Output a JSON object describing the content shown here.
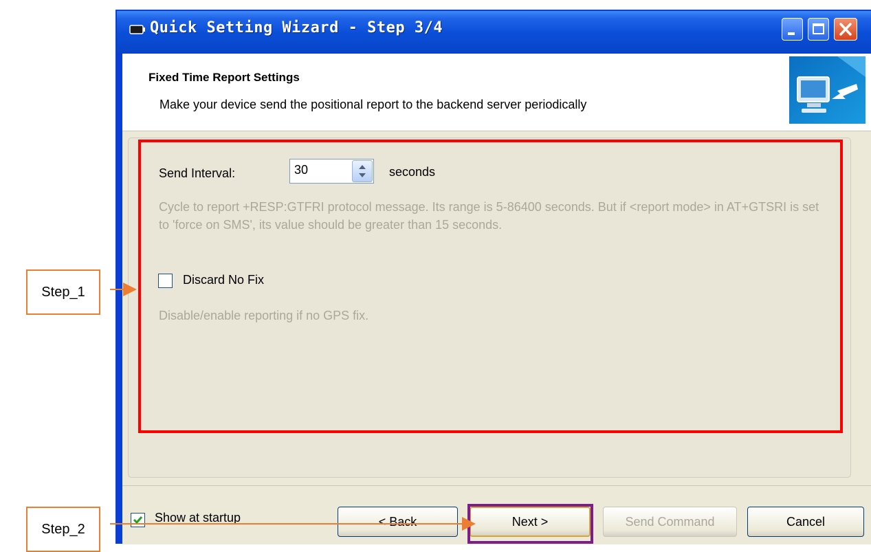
{
  "window": {
    "title": "Quick Setting Wizard - Step 3/4",
    "accent_color": "#0a4ed8",
    "controls": {
      "minimize_icon": "minimize-icon",
      "maximize_icon": "maximize-icon",
      "close_icon": "close-icon"
    }
  },
  "header": {
    "title": "Fixed Time Report Settings",
    "subtitle": "Make your device send the positional report to the backend server periodically",
    "icon": "monitor-arrow-icon"
  },
  "form": {
    "send_interval": {
      "label": "Send Interval:",
      "value": "30",
      "unit": "seconds",
      "hint": "Cycle to report +RESP:GTFRI protocol message. Its range is 5-86400 seconds. But if <report mode> in AT+GTSRI is set to 'force on SMS', its value should be greater than 15 seconds."
    },
    "discard_no_fix": {
      "label": "Discard No Fix",
      "checked": false,
      "hint": "Disable/enable reporting if no GPS fix."
    }
  },
  "footer": {
    "show_at_startup": {
      "label": "Show at startup",
      "checked": true
    },
    "buttons": {
      "back": "< Back",
      "next": "Next >",
      "send_command": "Send Command",
      "cancel": "Cancel"
    }
  },
  "annotations": {
    "step1": "Step_1",
    "step2": "Step_2",
    "highlight_color": "#ff0000",
    "callout_color": "#ed7d31",
    "next_highlight_color": "#7d1d8c"
  }
}
